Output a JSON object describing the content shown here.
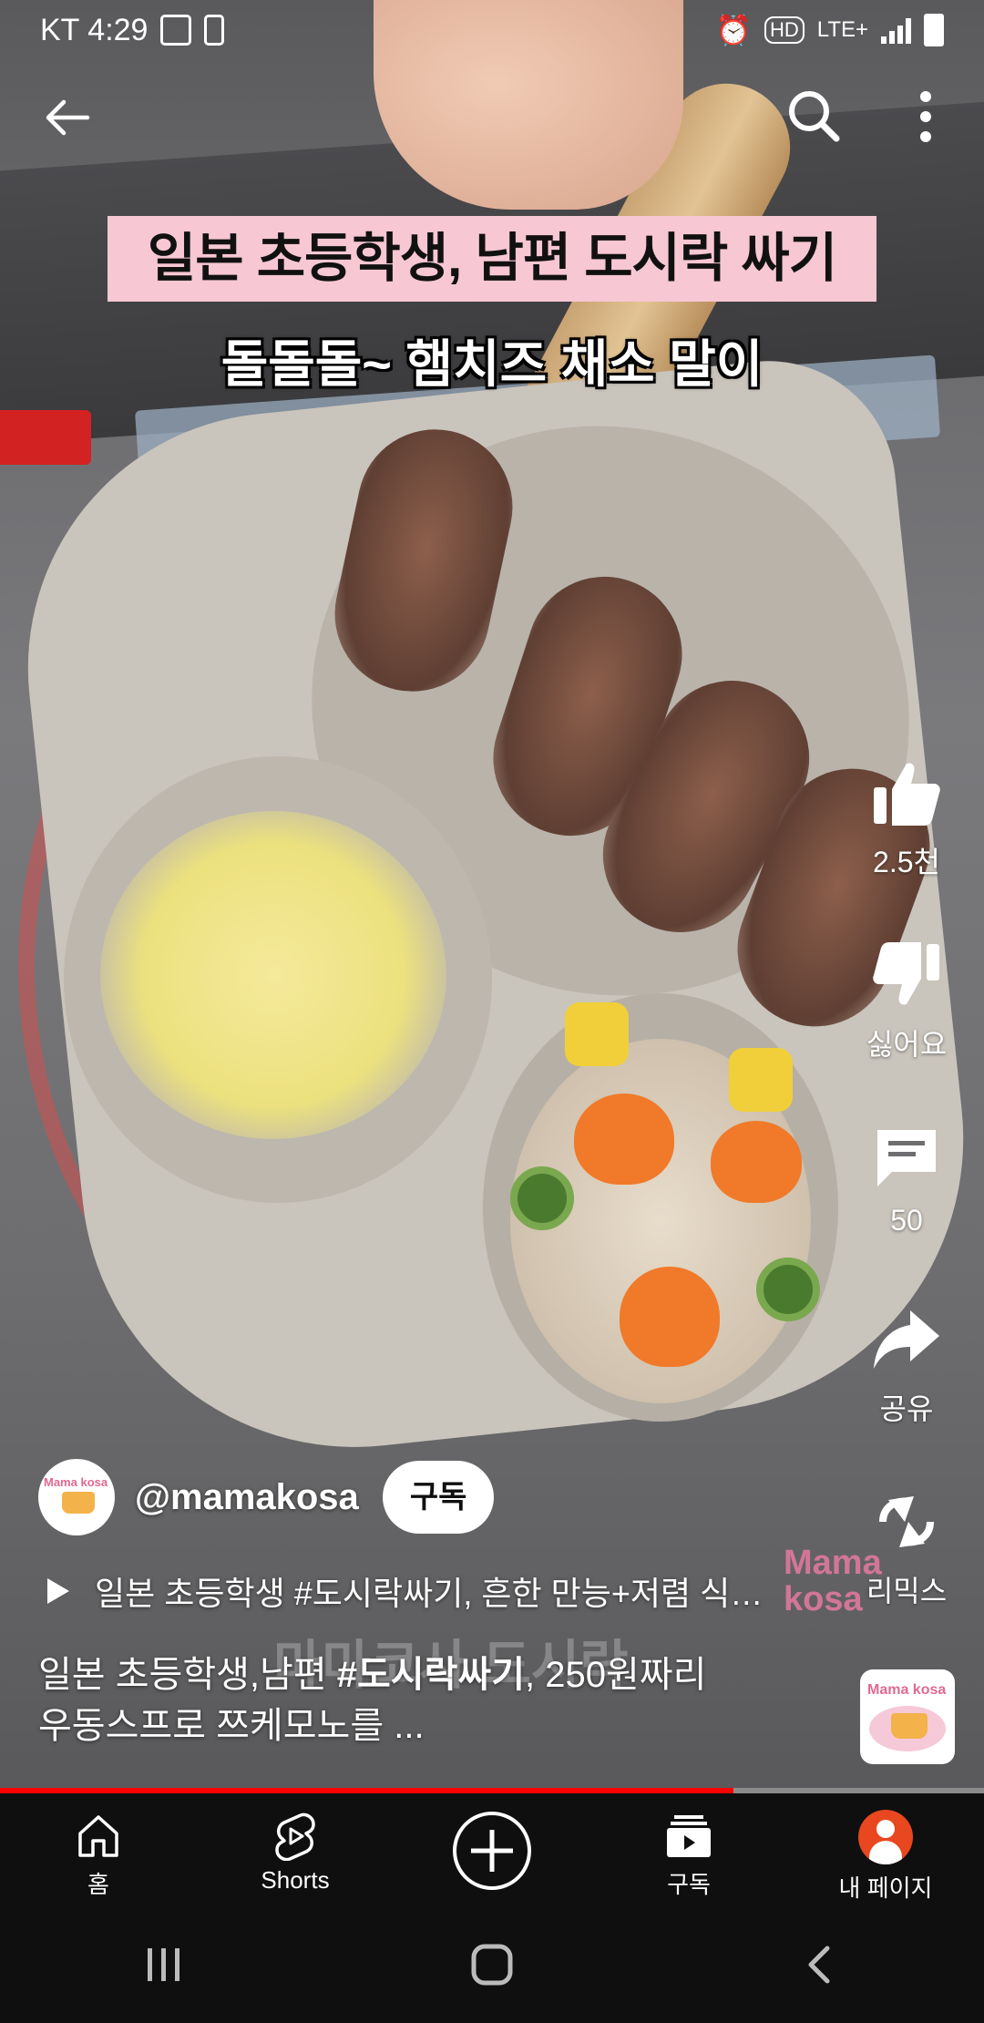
{
  "status_bar": {
    "carrier_time": "KT 4:29",
    "network": "LTE+"
  },
  "video": {
    "caption_line1": "일본 초등학생, 남편 도시락 싸기",
    "caption_line2": "돌돌돌~ 햄치즈 채소 말이",
    "watermark": "마마코사 도시락",
    "watermark_logo": "Mama kosa"
  },
  "actions": {
    "like_count": "2.5천",
    "dislike_label": "싫어요",
    "comment_count": "50",
    "share_label": "공유",
    "remix_label": "리믹스"
  },
  "channel": {
    "handle": "@mamakosa",
    "subscribe_label": "구독",
    "avatar_text": "Mama kosa"
  },
  "related": {
    "title": "일본 초등학생 #도시락싸기, 흔한 만능+저렴 식…"
  },
  "description": {
    "line1_pre": "일본 초등학생,남편 ",
    "line1_tag": "#도시락싸기",
    "line1_post": ",  250원짜리",
    "line2": "우동스프로 쯔케모노를 ..."
  },
  "progress": {
    "fraction": 0.745
  },
  "bottom_nav": {
    "home_label": "홈",
    "shorts_label": "Shorts",
    "subs_label": "구독",
    "me_label": "내 페이지"
  },
  "colors": {
    "progress_red": "#ff0000",
    "caption_pink": "#f7c7d3",
    "me_avatar": "#e8471f"
  }
}
